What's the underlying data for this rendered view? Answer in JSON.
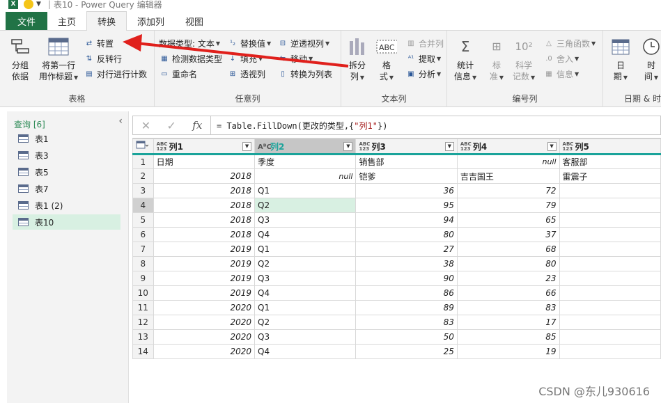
{
  "titlebar": {
    "app_title": "表10 - Power Query 编辑器",
    "separator": "|"
  },
  "tabs": [
    "文件",
    "主页",
    "转换",
    "添加列",
    "视图"
  ],
  "ribbon": {
    "table_group": {
      "label": "表格",
      "group_by": [
        "分组",
        "依据"
      ],
      "use_first_row": [
        "将第一行",
        "用作标题"
      ],
      "transpose": "转置",
      "reverse_rows": "反转行",
      "count_rows": "对行进行计数"
    },
    "any_column_group": {
      "label": "任意列",
      "data_type": "数据类型: 文本",
      "detect_type": "检测数据类型",
      "rename": "重命名",
      "replace_values": "替换值",
      "fill": "填充",
      "pivot_column": "透视列",
      "unpivot": "逆透视列",
      "move": "移动",
      "convert_to_list": "转换为列表"
    },
    "text_column_group": {
      "label": "文本列",
      "split": [
        "拆分",
        "列"
      ],
      "format": [
        "格",
        "式"
      ],
      "merge": "合并列",
      "extract": "提取",
      "parse": "分析"
    },
    "number_column_group": {
      "label": "编号列",
      "statistics": [
        "统计",
        "信息"
      ],
      "standard": [
        "标",
        "准"
      ],
      "scientific": [
        "科学",
        "记数"
      ],
      "trig": "三角函数",
      "rounding": "舍入",
      "information": "信息"
    },
    "datetime_group": {
      "label": "日期 & 时",
      "date": [
        "日",
        "期"
      ],
      "time": [
        "时",
        "间"
      ]
    }
  },
  "queries": {
    "header": "查询 [6]",
    "items": [
      "表1",
      "表3",
      "表5",
      "表7",
      "表1 (2)",
      "表10"
    ],
    "selected": "表10"
  },
  "formula": {
    "prefix": "= Table.FillDown(更改的类型,{",
    "string": "\"列1\"",
    "suffix": "})"
  },
  "grid": {
    "columns": [
      {
        "name": "列1",
        "type": "ABC\n123"
      },
      {
        "name": "列2",
        "type": "A B C"
      },
      {
        "name": "列3",
        "type": "ABC\n123"
      },
      {
        "name": "列4",
        "type": "ABC\n123"
      },
      {
        "name": "列5",
        "type": "ABC\n123"
      }
    ],
    "rows": [
      [
        "1",
        "日期",
        "季度",
        "销售部",
        "null",
        "客服部"
      ],
      [
        "2",
        "2018",
        "null",
        "铠爹",
        "吉吉国王",
        "雷震子"
      ],
      [
        "3",
        "2018",
        "Q1",
        "36",
        "72",
        ""
      ],
      [
        "4",
        "2018",
        "Q2",
        "95",
        "79",
        ""
      ],
      [
        "5",
        "2018",
        "Q3",
        "94",
        "65",
        ""
      ],
      [
        "6",
        "2018",
        "Q4",
        "80",
        "37",
        ""
      ],
      [
        "7",
        "2019",
        "Q1",
        "27",
        "68",
        ""
      ],
      [
        "8",
        "2019",
        "Q2",
        "38",
        "80",
        ""
      ],
      [
        "9",
        "2019",
        "Q3",
        "90",
        "23",
        ""
      ],
      [
        "10",
        "2019",
        "Q4",
        "86",
        "66",
        ""
      ],
      [
        "11",
        "2020",
        "Q1",
        "89",
        "83",
        ""
      ],
      [
        "12",
        "2020",
        "Q2",
        "83",
        "17",
        ""
      ],
      [
        "13",
        "2020",
        "Q3",
        "50",
        "85",
        ""
      ],
      [
        "14",
        "2020",
        "Q4",
        "25",
        "19",
        ""
      ]
    ],
    "selected_row": 4
  },
  "watermark": "CSDN @东儿930616",
  "colors": {
    "accent": "#217346",
    "header_line": "#1aa39a",
    "selection": "#d8f0e2",
    "arrow": "#e0201c"
  }
}
